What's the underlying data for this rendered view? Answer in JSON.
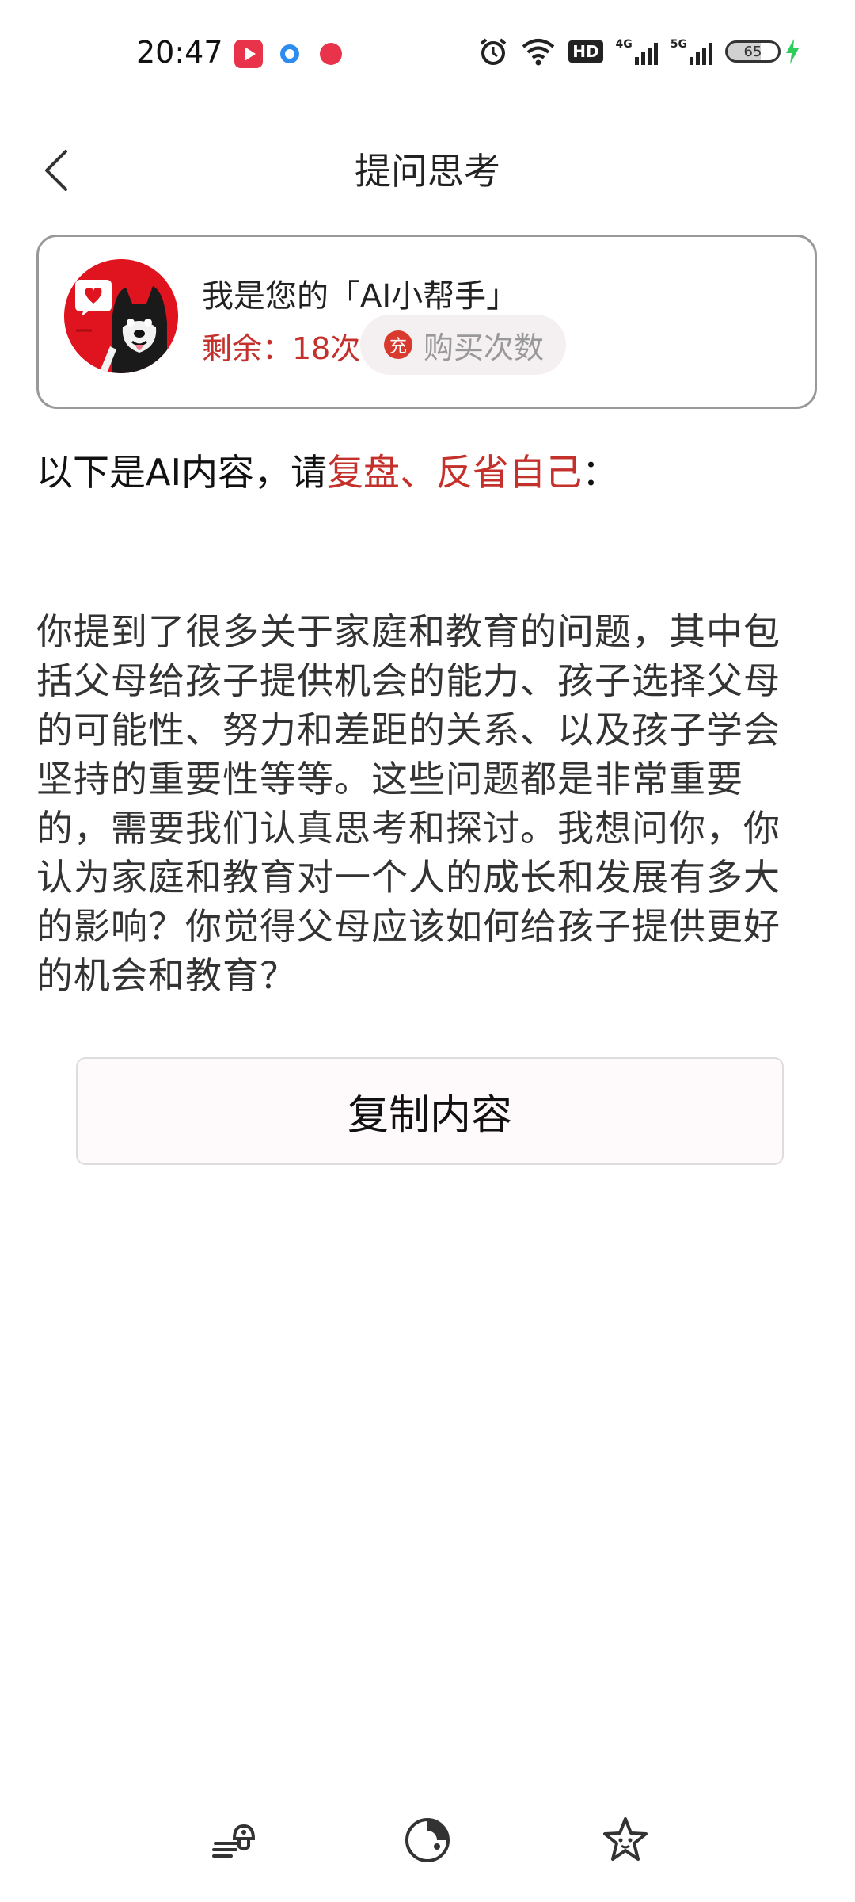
{
  "status_bar": {
    "time": "20:47",
    "notification_icons": [
      "video-app-icon",
      "blue-dot-app-icon",
      "red-record-app-icon"
    ],
    "system_icons": [
      "alarm-icon",
      "wifi-icon",
      "hd-icon",
      "4g-signal-icon",
      "5g-signal-icon",
      "battery-icon",
      "charging-icon"
    ],
    "hd_label": "HD",
    "net1_label": "4G",
    "net2_label": "5G",
    "battery_level": "65"
  },
  "header": {
    "title": "提问思考"
  },
  "ai_card": {
    "name": "我是您的「AI小帮手」",
    "remaining": "剩余：18次",
    "charge_badge": "充",
    "buy_label": "购买次数",
    "avatar_icon": "dog-avatar-icon",
    "accent_color": "#c4302b"
  },
  "intro": {
    "prefix": "以下是AI内容，请",
    "highlight": "复盘、反省自己",
    "suffix": "："
  },
  "content": {
    "text": "你提到了很多关于家庭和教育的问题，其中包括父母给孩子提供机会的能力、孩子选择父母的可能性、努力和差距的关系、以及孩子学会坚持的重要性等等。这些问题都是非常重要的，需要我们认真思考和探讨。我想问你，你认为家庭和教育对一个人的成长和发展有多大的影响？你觉得父母应该如何给孩子提供更好的机会和教育？"
  },
  "copy_button": {
    "label": "复制内容"
  },
  "bottom_nav": {
    "items": [
      "tools-icon",
      "clock-icon",
      "star-face-icon"
    ]
  }
}
